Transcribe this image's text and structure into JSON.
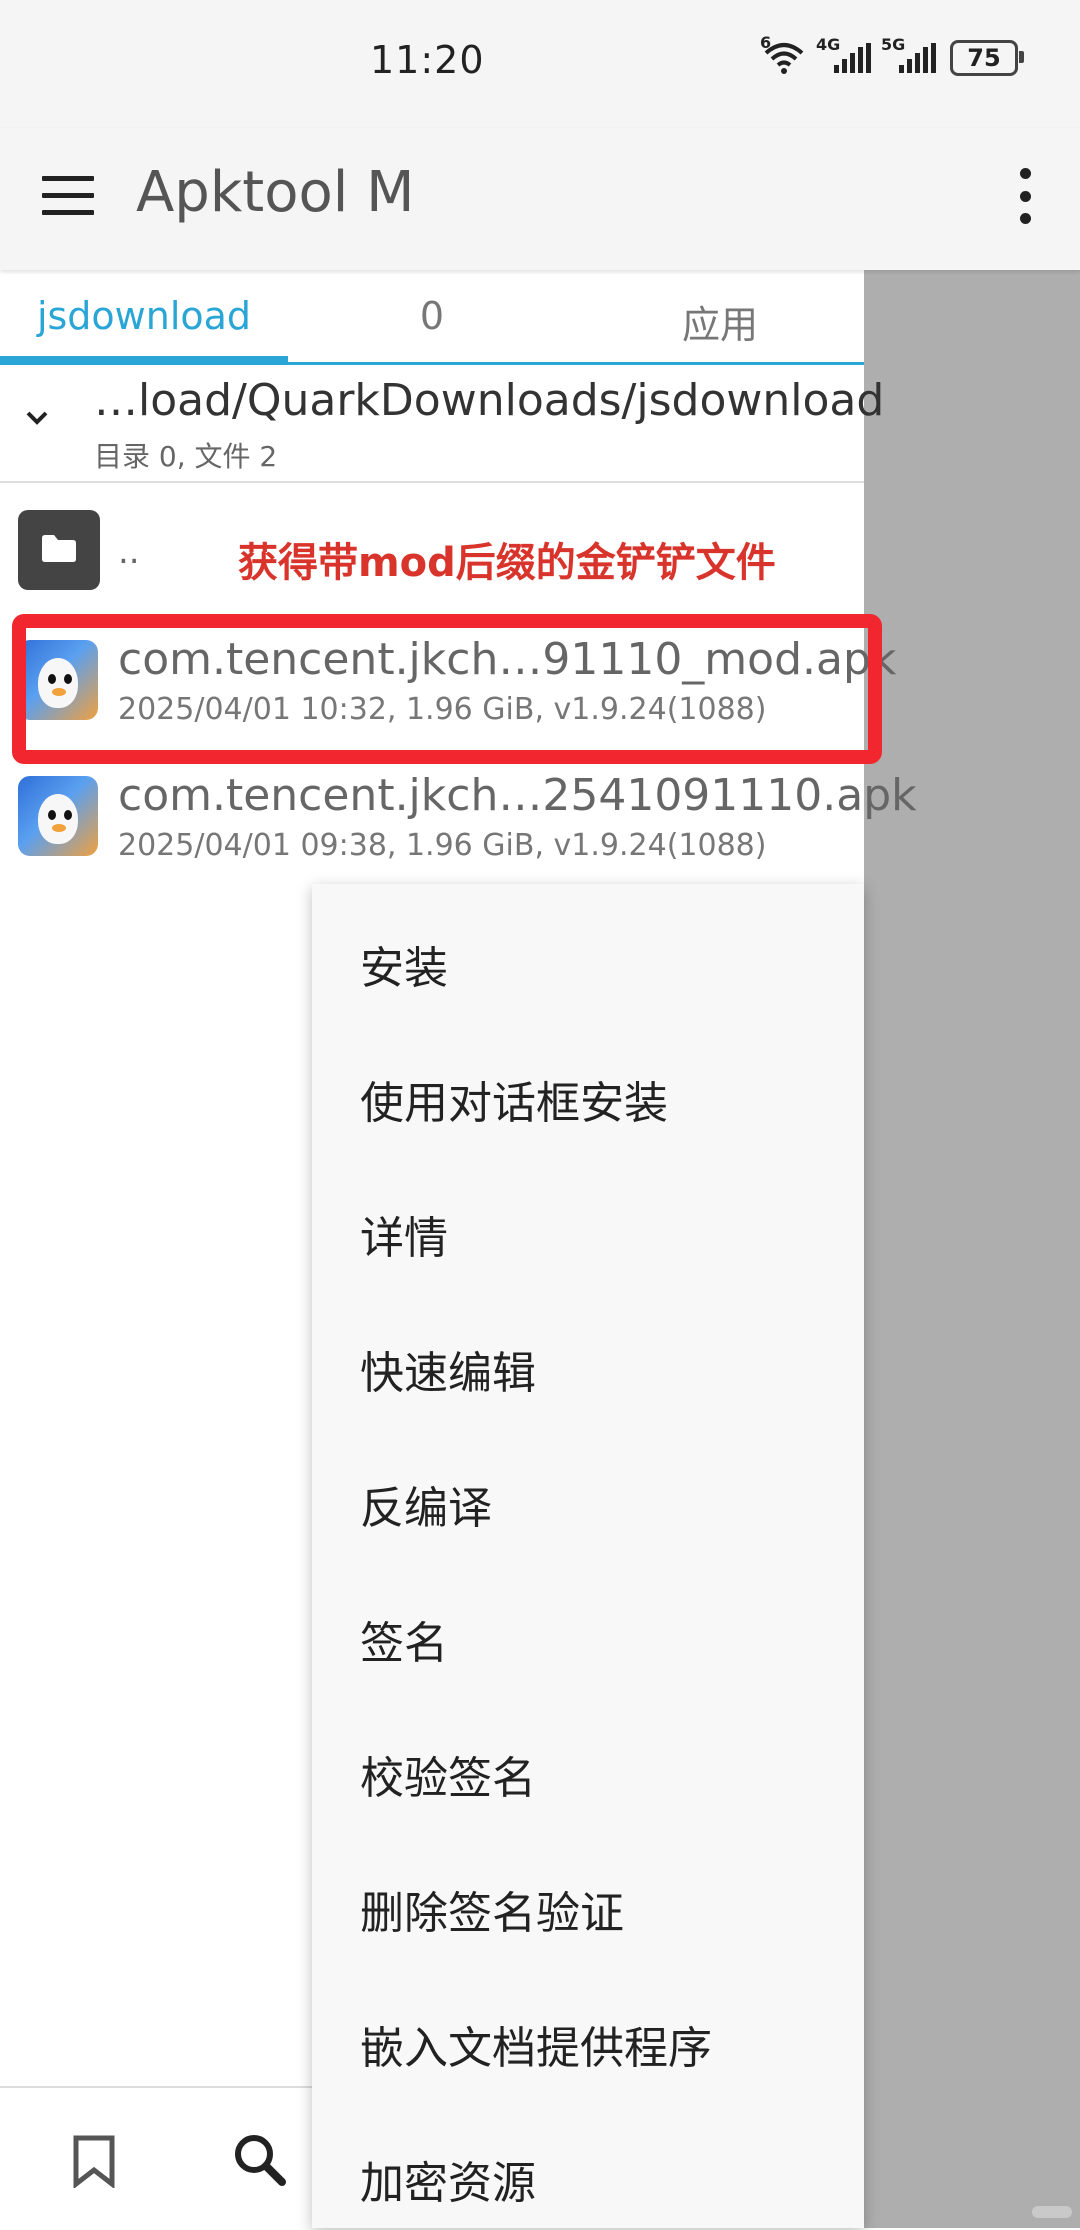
{
  "status_bar": {
    "time": "11:20",
    "wifi_tag": "6",
    "sim1_tag": "4G",
    "sim2_tag": "5G",
    "battery": "75"
  },
  "app_bar": {
    "title": "Apktool M",
    "menu_icon": "hamburger-icon",
    "more_icon": "more-vert-icon"
  },
  "tabs": [
    {
      "label": "jsdownload",
      "active": true
    },
    {
      "label": "0",
      "active": false
    },
    {
      "label": "应用",
      "active": false
    }
  ],
  "path": {
    "text": "…load/QuarkDownloads/jsdownload",
    "summary": "目录 0, 文件 2"
  },
  "parent_row": {
    "label": "..",
    "annotation": "获得带mod后缀的金铲铲文件"
  },
  "files": [
    {
      "name": "com.tencent.jkch…91110_mod.apk",
      "meta": "2025/04/01 10:32, 1.96 GiB, v1.9.24(1088)"
    },
    {
      "name": "com.tencent.jkch…2541091110.apk",
      "meta": "2025/04/01 09:38, 1.96 GiB, v1.9.24(1088)"
    }
  ],
  "menu": {
    "items": [
      "安装",
      "使用对话框安装",
      "详情",
      "快速编辑",
      "反编译",
      "签名",
      "校验签名",
      "删除签名验证",
      "嵌入文档提供程序",
      "加密资源"
    ]
  },
  "colors": {
    "accent": "#2aa6d6",
    "annotation": "#d9342b",
    "highlight": "#f2262e"
  }
}
